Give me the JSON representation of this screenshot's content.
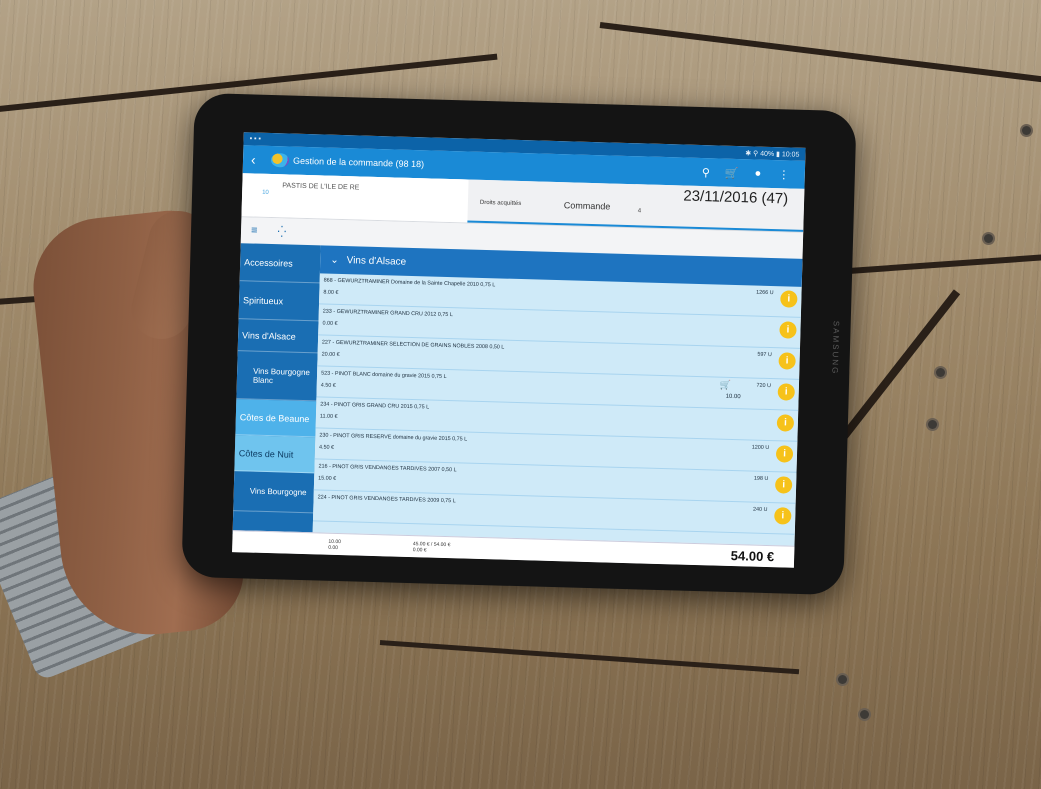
{
  "scene": {
    "device_brand": "SAMSUNG"
  },
  "status_bar": {
    "right": "✱ ⚲ 40% ▮ 10:05"
  },
  "app_bar": {
    "title": "Gestion de la commande (98 18)"
  },
  "customer": {
    "name": "PASTIS DE L'ILE DE RE",
    "code": "10"
  },
  "order": {
    "duties": "Droits acquittés",
    "type": "Commande",
    "date": "23/11/2016 (47)",
    "count": "4"
  },
  "categories": [
    {
      "label": "Accessoires"
    },
    {
      "label": "Spiritueux"
    },
    {
      "label": "Vins d'Alsace"
    },
    {
      "label": "Vins Bourgogne Blanc"
    },
    {
      "label": "Côtes de Beaune"
    },
    {
      "label": "Côtes de Nuit"
    },
    {
      "label": "Vins Bourgogne"
    }
  ],
  "list_header": "Vins d'Alsace",
  "products": [
    {
      "name": "868 - GEWURZTRAMINER Domaine de la Sainte Chapelle 2010 0,75 L",
      "price": "8.00 €",
      "stock": "1266 U"
    },
    {
      "name": "233 - GEWURZTRAMINER GRAND CRU 2012 0,75 L",
      "price": "0.00 €",
      "stock": ""
    },
    {
      "name": "227 - GEWURZTRAMINER SELECTION DE GRAINS NOBLES 2008 0,50 L",
      "price": "20.00 €",
      "stock": "597 U"
    },
    {
      "name": "523 - PINOT BLANC domaine du gravie 2015 0,75 L",
      "price": "4.50 €",
      "stock": "720 U",
      "cart_qty": "10.00"
    },
    {
      "name": "234 - PINOT GRIS GRAND CRU 2015 0,75 L",
      "price": "11.00 €",
      "stock": ""
    },
    {
      "name": "230 - PINOT GRIS RESERVE domaine du gravie 2015 0,75 L",
      "price": "4.50 €",
      "stock": "1200 U"
    },
    {
      "name": "216 - PINOT GRIS VENDANGES TARDIVES 2007 0,50 L",
      "price": "15.00 €",
      "stock": "198 U"
    },
    {
      "name": "224 - PINOT GRIS VENDANGES TARDIVES 2009 0,75 L",
      "price": "",
      "stock": "240 U"
    }
  ],
  "footer": {
    "qty1": "10.00",
    "qty2": "0.00",
    "amount": "45.00 € / 54.00 €",
    "amount2": "0.00 €",
    "total": "54.00 €"
  }
}
